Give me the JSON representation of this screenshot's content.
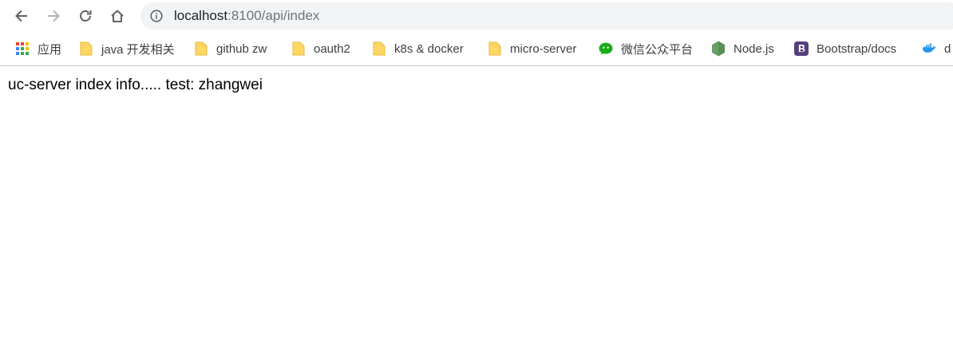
{
  "browser": {
    "address_bar": {
      "host": "localhost",
      "rest": ":8100/api/index"
    },
    "bookmarks": [
      {
        "label": "应用",
        "icon": "apps-grid-icon"
      },
      {
        "label": "java 开发相关",
        "icon": "folder-icon"
      },
      {
        "label": "github zw",
        "icon": "folder-icon"
      },
      {
        "label": "oauth2",
        "icon": "folder-icon"
      },
      {
        "label": "k8s & docker",
        "icon": "folder-icon"
      },
      {
        "label": "micro-server",
        "icon": "folder-icon"
      },
      {
        "label": "微信公众平台",
        "icon": "wechat-icon"
      },
      {
        "label": "Node.js",
        "icon": "nodejs-icon"
      },
      {
        "label": "Bootstrap/docs",
        "icon": "bootstrap-icon"
      },
      {
        "label": "d",
        "icon": "docker-icon"
      }
    ]
  },
  "page": {
    "body_text": "uc-server index info..... test: zhangwei"
  },
  "colors": {
    "folder": "#fdd663",
    "wechat": "#1aad19",
    "nodejs": "#68a063",
    "bootstrap": "#563d7c",
    "docker": "#2496ed"
  }
}
